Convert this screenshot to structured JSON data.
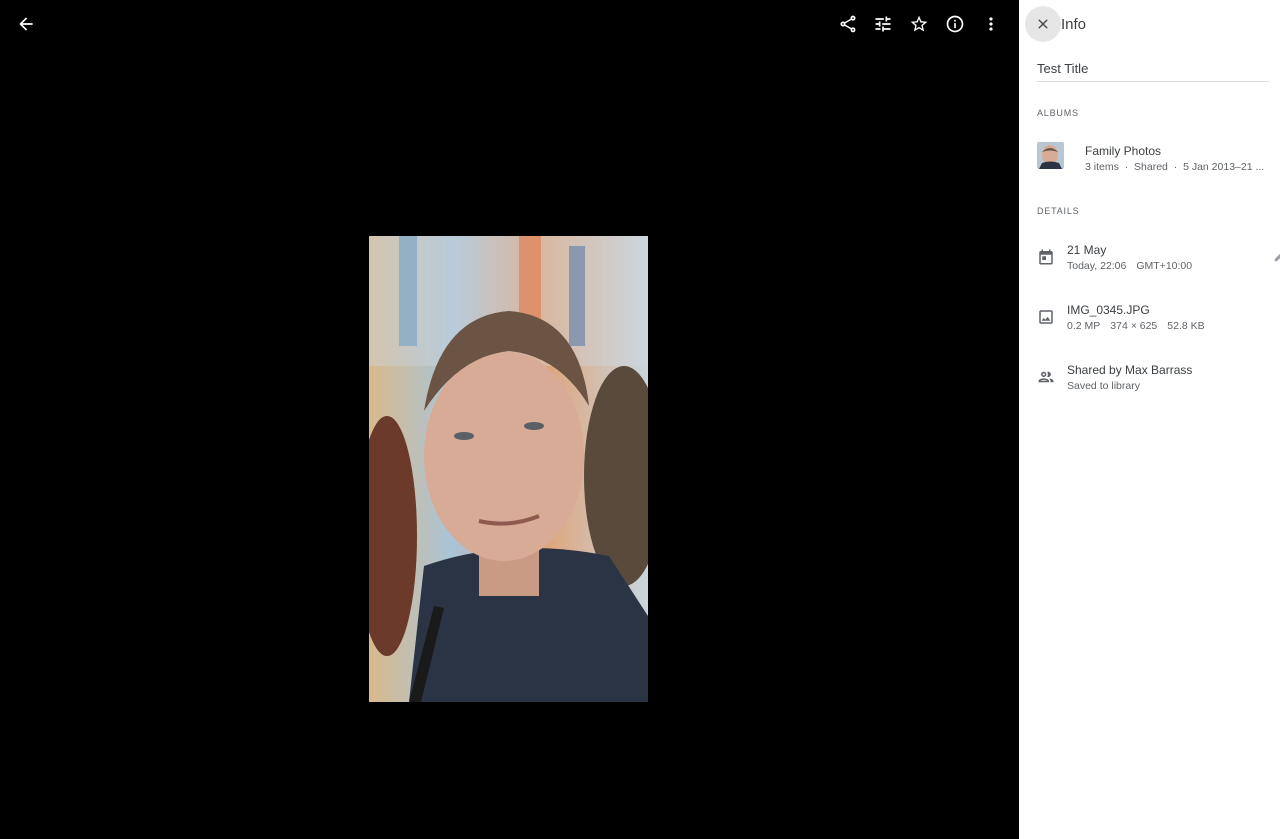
{
  "viewer": {
    "back_icon": "arrow-back-icon",
    "toolbar_icons": [
      "share-icon",
      "tune-icon",
      "star-outline-icon",
      "info-icon",
      "more-vert-icon"
    ]
  },
  "info_panel": {
    "title": "Info",
    "photo_title_value": "Test Title",
    "albums_label": "ALBUMS",
    "album": {
      "name": "Family Photos",
      "items": "3 items",
      "sep": "·",
      "shared": "Shared",
      "range": "5 Jan 2013–21 ..."
    },
    "details_label": "DETAILS",
    "date": {
      "primary": "21 May",
      "time": "Today, 22:06",
      "timezone": "GMT+10:00"
    },
    "file": {
      "name": "IMG_0345.JPG",
      "megapixels": "0.2 MP",
      "dimensions": "374 × 625",
      "size": "52.8 KB"
    },
    "sharing": {
      "primary": "Shared by Max Barrass",
      "secondary": "Saved to library"
    }
  }
}
